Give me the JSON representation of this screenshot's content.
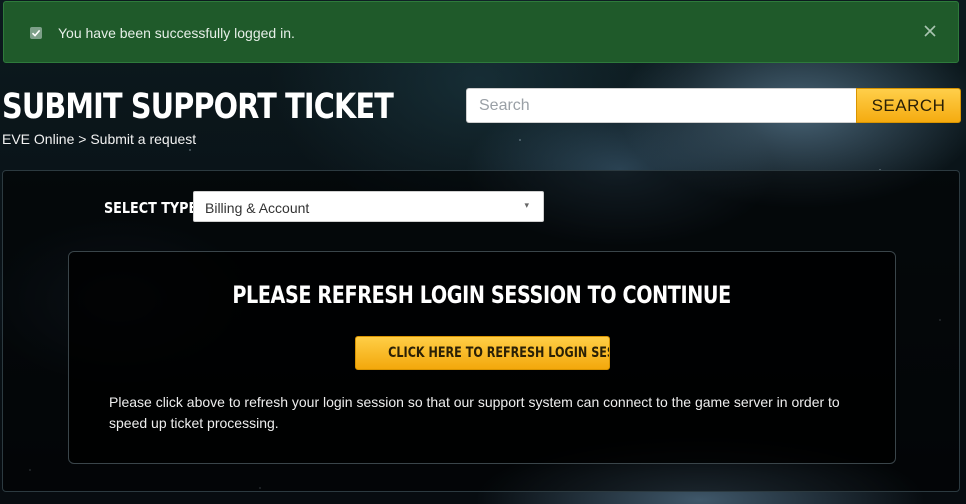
{
  "alert": {
    "message": "You have been successfully logged in.",
    "icon": "check-icon",
    "close_icon": "close-icon",
    "color": "#1f5a2a"
  },
  "header": {
    "title": "SUBMIT SUPPORT TICKET",
    "breadcrumb": "EVE Online > Submit a request"
  },
  "search": {
    "placeholder": "Search",
    "value": "",
    "button_label": "SEARCH",
    "button_color": "#f5ab10"
  },
  "form": {
    "select_type_label": "SELECT TYPE",
    "selected_type": "Billing & Account",
    "select_arrow": "▾"
  },
  "card": {
    "heading": "PLEASE REFRESH LOGIN SESSION TO CONTINUE",
    "button_label": "CLICK HERE TO REFRESH LOGIN SESSION",
    "description": "Please click above to refresh your login session so that our support system can connect to the game server in order to speed up ticket processing."
  }
}
